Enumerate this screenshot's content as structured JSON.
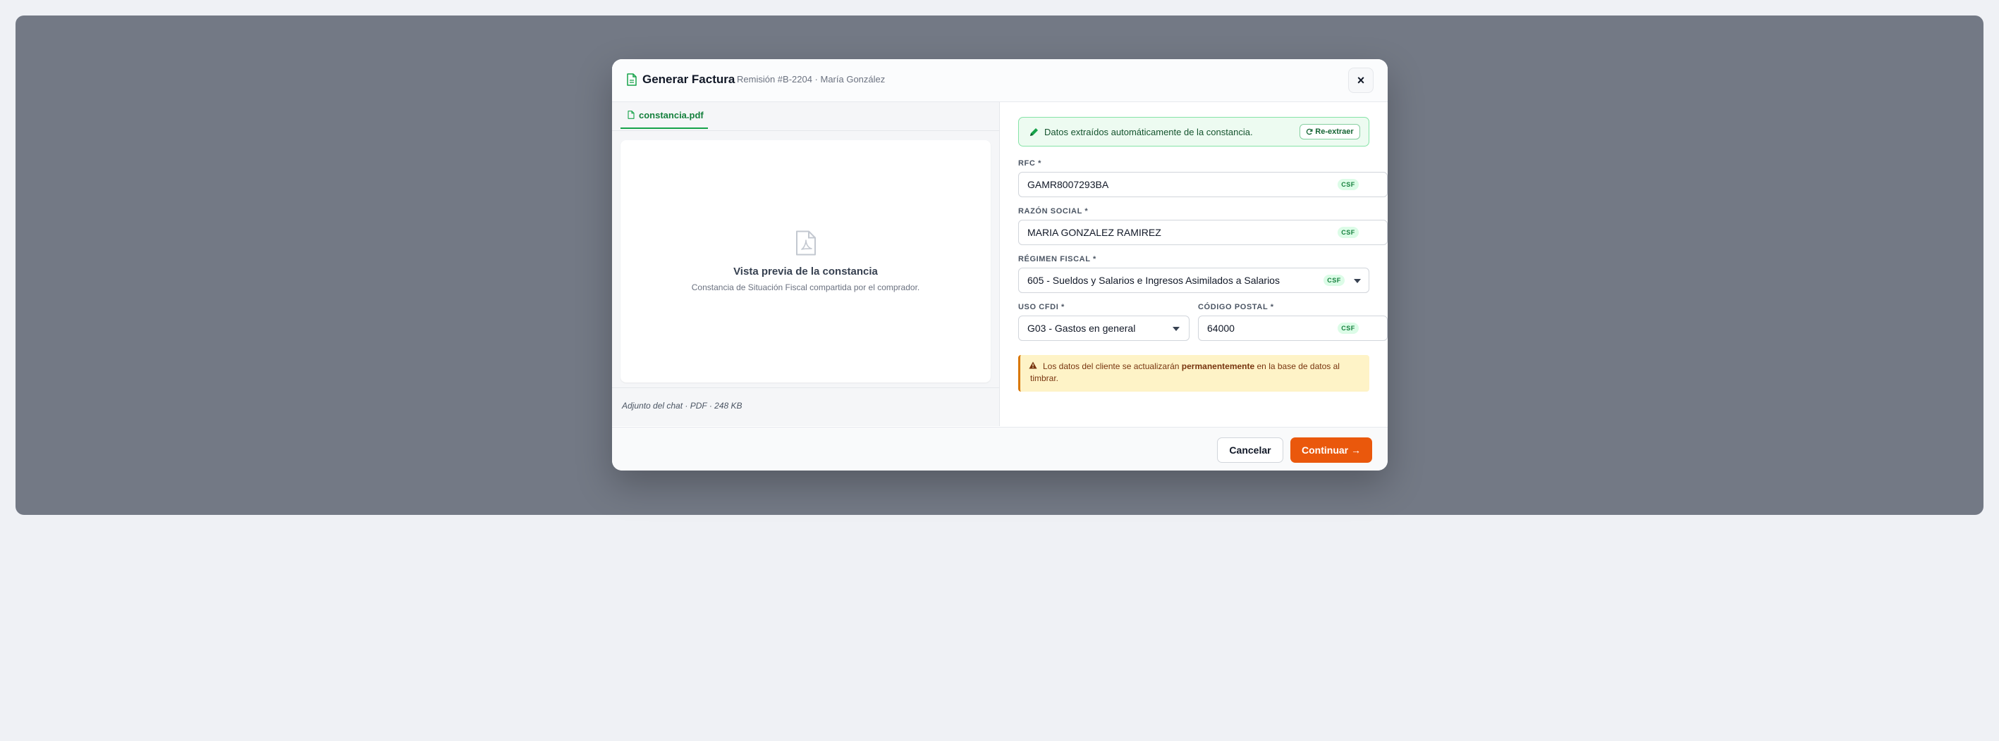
{
  "modal": {
    "title": "Generar Factura",
    "subtitle": "Remisión #B-2204 · María González",
    "close_label": "×"
  },
  "preview": {
    "tab_label": "constancia.pdf",
    "title": "Vista previa de la constancia",
    "subtitle": "Constancia de Situación Fiscal compartida por el comprador.",
    "attachment_info": "Adjunto del chat · PDF · 248 KB"
  },
  "form": {
    "extracted_notice": "Datos extraídos automáticamente de la constancia.",
    "reextract_label": "Re-extraer",
    "badge_label": "CSF",
    "rfc": {
      "label": "RFC *",
      "value": "GAMR8007293BA"
    },
    "razon_social": {
      "label": "RAZÓN SOCIAL *",
      "value": "MARIA GONZALEZ RAMIREZ"
    },
    "regimen_fiscal": {
      "label": "RÉGIMEN FISCAL *",
      "value": "605 - Sueldos y Salarios e Ingresos Asimilados a Salarios"
    },
    "uso_cfdi": {
      "label": "USO CFDI *",
      "value": "G03 - Gastos en general"
    },
    "codigo_postal": {
      "label": "CÓDIGO POSTAL *",
      "value": "64000"
    },
    "warning": {
      "before": "Los datos del cliente se actualizarán ",
      "bold": "permanentemente",
      "after": " en la base de datos al timbrar."
    }
  },
  "footer": {
    "cancel_label": "Cancelar",
    "continue_label": "Continuar →"
  },
  "colors": {
    "accent": "#ea580c",
    "success": "#16a34a",
    "warning": "#d97706",
    "backdrop": "#737985"
  }
}
